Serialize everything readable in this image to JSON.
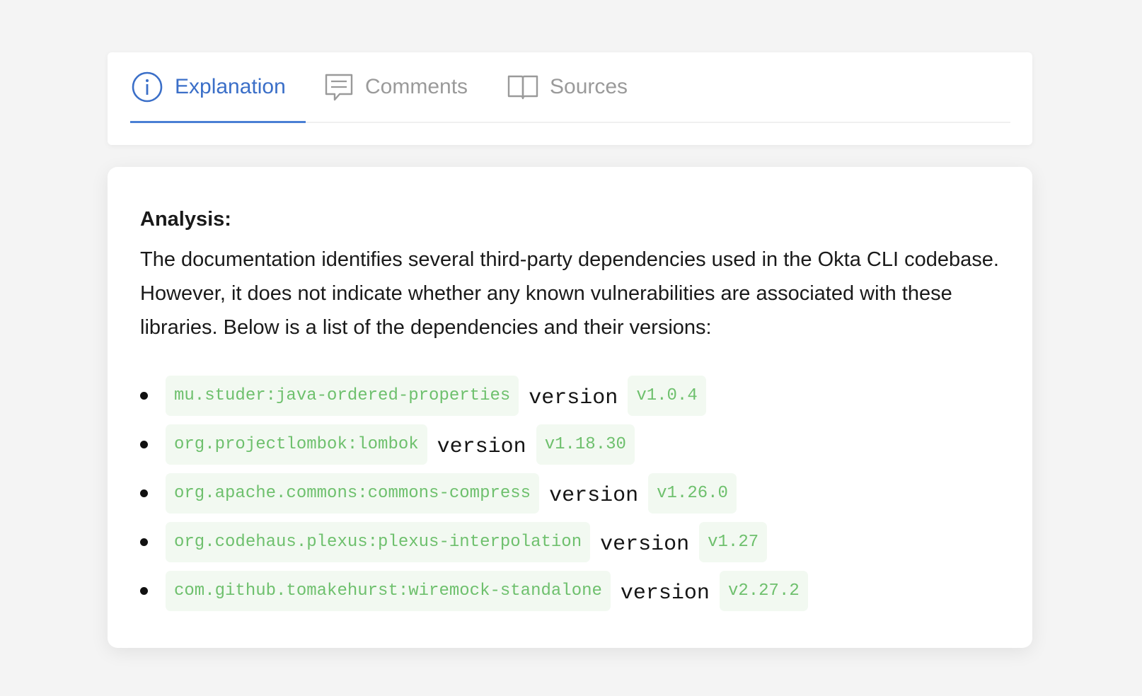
{
  "tabs": [
    {
      "label": "Explanation",
      "icon": "info-icon",
      "active": true
    },
    {
      "label": "Comments",
      "icon": "comment-icon",
      "active": false
    },
    {
      "label": "Sources",
      "icon": "book-icon",
      "active": false
    }
  ],
  "analysis": {
    "title": "Analysis:",
    "paragraph": "The documentation identifies several third-party dependencies used in the Okta CLI codebase. However, it does not indicate whether any known vulnerabilities are associated with these libraries. Below is a list of the dependencies and their versions:"
  },
  "dependencies": [
    {
      "name": "mu.studer:java-ordered-properties",
      "version_word": "version",
      "version": "v1.0.4"
    },
    {
      "name": "org.projectlombok:lombok",
      "version_word": "version",
      "version": "v1.18.30"
    },
    {
      "name": "org.apache.commons:commons-compress",
      "version_word": "version",
      "version": "v1.26.0"
    },
    {
      "name": "org.codehaus.plexus:plexus-interpolation",
      "version_word": "version",
      "version": "v1.27"
    },
    {
      "name": "com.github.tomakehurst:wiremock-standalone",
      "version_word": "version",
      "version": "v2.27.2"
    }
  ],
  "colors": {
    "accent": "#3b6fc8",
    "inactive_tab": "#9a9a9a",
    "code_text": "#6ec06d",
    "code_bg": "#f2f9f1"
  }
}
